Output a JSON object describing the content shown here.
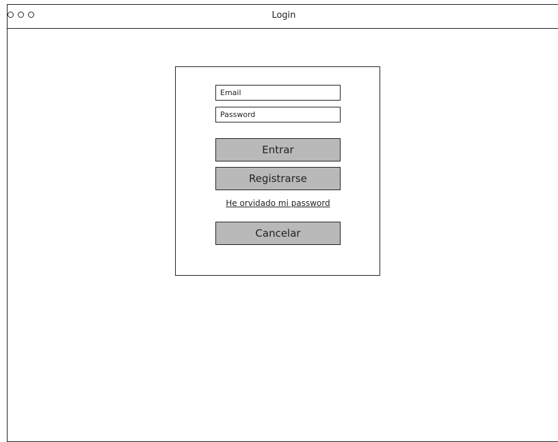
{
  "window": {
    "title": "Login"
  },
  "form": {
    "email_placeholder": "Email",
    "password_placeholder": "Password",
    "login_label": "Entrar",
    "register_label": "Registrarse",
    "forgot_link": "He orvidado mi password",
    "cancel_label": "Cancelar"
  },
  "colors": {
    "button_fill": "#b9b9b9",
    "stroke": "#222222"
  }
}
